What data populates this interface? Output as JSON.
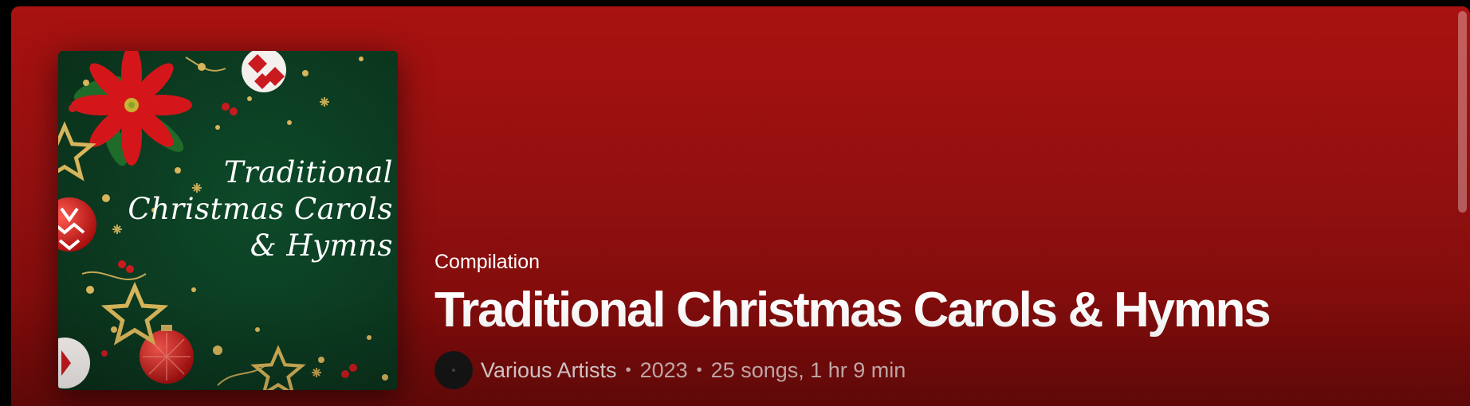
{
  "album": {
    "cover_title_lines": [
      "Traditional",
      "Christmas Carols",
      "& Hymns"
    ],
    "type_label": "Compilation",
    "title": "Traditional Christmas Carols & Hymns",
    "artist": "Various Artists",
    "year": "2023",
    "stats": "25 songs, 1 hr 9 min",
    "separator": "•"
  },
  "icons": {
    "artist_avatar": "artist-avatar-icon",
    "poinsettia": "poinsettia-icon",
    "ornament": "ornament-icon",
    "star": "star-icon"
  },
  "colors": {
    "header_gradient_top": "#a81210",
    "header_gradient_bottom": "#730a0a",
    "cover_background": "#0f3a22",
    "text_primary": "#ffffff",
    "text_secondary": "#e0c8c8"
  }
}
